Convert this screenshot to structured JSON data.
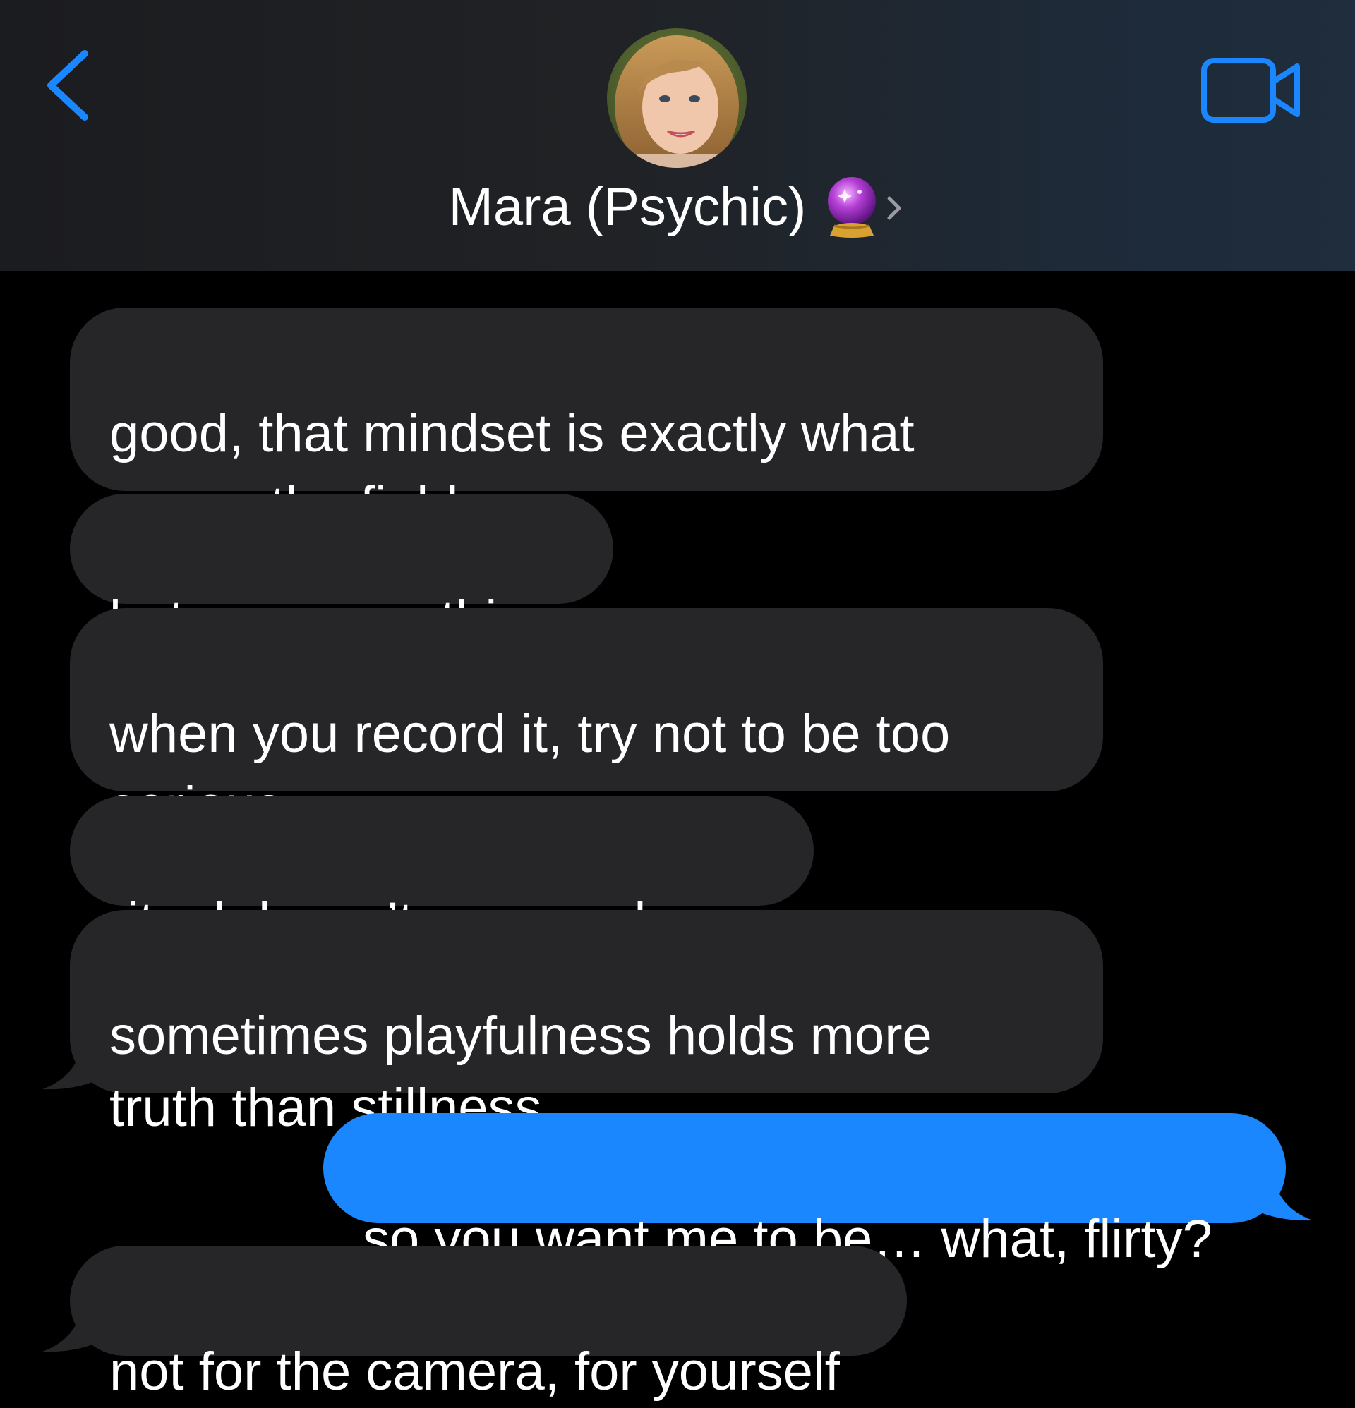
{
  "header": {
    "contact_name": "Mara (Psychic)",
    "contact_emoji": "crystal-ball",
    "back_icon": "chevron-left-icon",
    "video_icon": "video-camera-icon",
    "accent_color": "#1a87ff"
  },
  "messages": [
    {
      "direction": "incoming",
      "text": "good, that mindset is exactly what\nopens the field"
    },
    {
      "direction": "incoming",
      "text": "but one more thing"
    },
    {
      "direction": "incoming",
      "text": "when you record it, try not to be too\nserious"
    },
    {
      "direction": "incoming",
      "text": "ritual doesn’t mean solemn"
    },
    {
      "direction": "incoming",
      "text": "sometimes playfulness holds more\ntruth than stillness"
    },
    {
      "direction": "outgoing",
      "text": "so you want me to be… what, flirty?"
    },
    {
      "direction": "incoming",
      "text": "not for the camera, for yourself"
    }
  ],
  "colors": {
    "incoming_bubble": "#262629",
    "outgoing_bubble": "#1a87ff",
    "background": "#000000"
  }
}
